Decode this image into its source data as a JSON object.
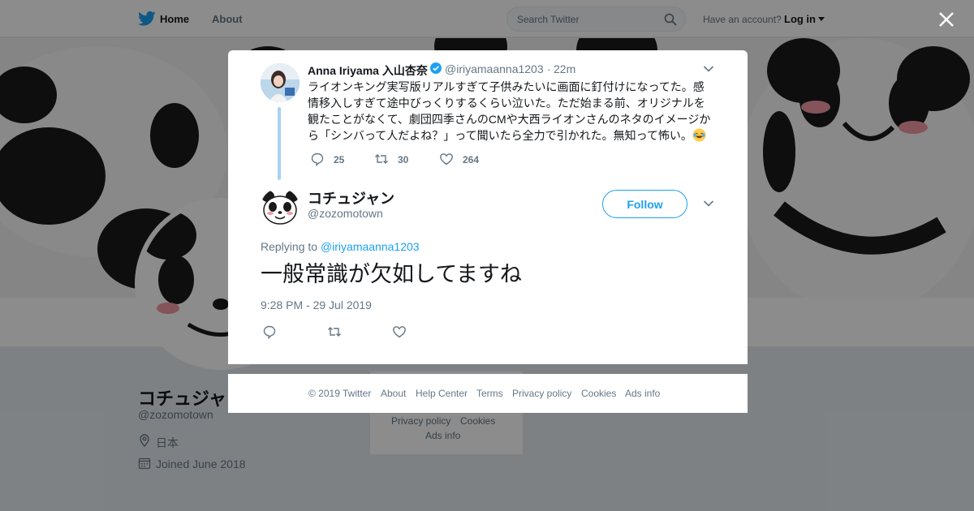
{
  "nav": {
    "home": "Home",
    "about": "About",
    "search_placeholder": "Search Twitter",
    "have_account": "Have an account?",
    "login": "Log in"
  },
  "profile_bg": {
    "name": "コチュジャ",
    "handle": "@zozomotown",
    "location": "日本",
    "joined": "Joined June 2018",
    "footer_privacy": "Privacy policy",
    "footer_cookies": "Cookies",
    "footer_ads": "Ads info"
  },
  "parent_tweet": {
    "name": "Anna Iriyama 入山杏奈",
    "handle": "@iriyamaanna1203",
    "dot": "·",
    "time": "22m",
    "text": "ライオンキング実写版リアルすぎて子供みたいに画面に釘付けになってた。感情移入しすぎて途中びっくりするくらい泣いた。ただ始まる前、オリジナルを観たことがなくて、劇団四季さんのCMや大西ライオンさんのネタのイメージから「シンバって人だよね？」って聞いたら全力で引かれた。無知って怖い。",
    "replies": "25",
    "retweets": "30",
    "likes": "264"
  },
  "main_tweet": {
    "name": "コチュジャン",
    "handle": "@zozomotown",
    "follow_label": "Follow",
    "replying_prefix": "Replying to",
    "replying_to": "@iriyamaanna1203",
    "text": "一般常識が欠如してますね",
    "datetime": "9:28 PM - 29 Jul 2019"
  },
  "footer": {
    "copyright": "© 2019 Twitter",
    "about": "About",
    "help": "Help Center",
    "terms": "Terms",
    "privacy": "Privacy policy",
    "cookies": "Cookies",
    "ads": "Ads info"
  },
  "colors": {
    "brand_blue": "#1da1f2",
    "muted": "#657786",
    "text": "#14171a",
    "thread_line": "#a6d4f2"
  },
  "icons": [
    "twitter-bird-icon",
    "search-icon",
    "close-icon",
    "verified-icon",
    "chevron-down-icon",
    "reply-icon",
    "retweet-icon",
    "like-icon",
    "location-icon",
    "calendar-icon",
    "laughing-emoji-icon"
  ]
}
